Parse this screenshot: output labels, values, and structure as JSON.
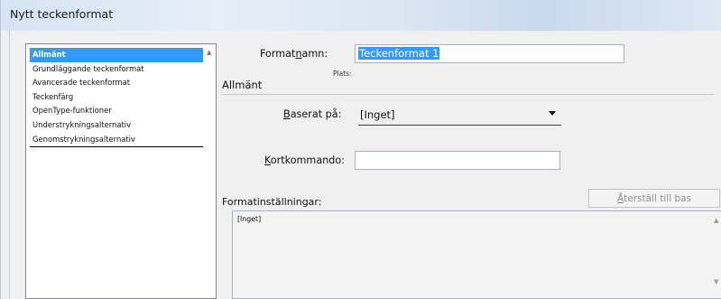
{
  "window": {
    "title": "Nytt teckenformat"
  },
  "sidebar": {
    "items": [
      {
        "label": "Allmänt",
        "selected": true
      },
      {
        "label": "Grundläggande teckenformat",
        "selected": false
      },
      {
        "label": "Avancerade teckenformat",
        "selected": false
      },
      {
        "label": "Teckenfärg",
        "selected": false
      },
      {
        "label": "OpenType-funktioner",
        "selected": false
      },
      {
        "label": "Understrykningsalternativ",
        "selected": false
      },
      {
        "label": "Genomstrykningsalternativ",
        "selected": false
      }
    ]
  },
  "form": {
    "format_name_label": "Formatnamn:",
    "format_name_value": "Teckenformat 1",
    "location_label": "Plats:",
    "section_title": "Allmänt",
    "based_on_label": "Baserat på:",
    "based_on_value": "[Inget]",
    "shortcut_label": "Kortkommando:",
    "shortcut_value": "",
    "settings_label": "Formatinställningar:",
    "reset_button_label": "Återställ till bas",
    "settings_text": "[Inget]"
  },
  "colors": {
    "selection": "#3399ff",
    "disabled_text": "#8f8f8f"
  }
}
